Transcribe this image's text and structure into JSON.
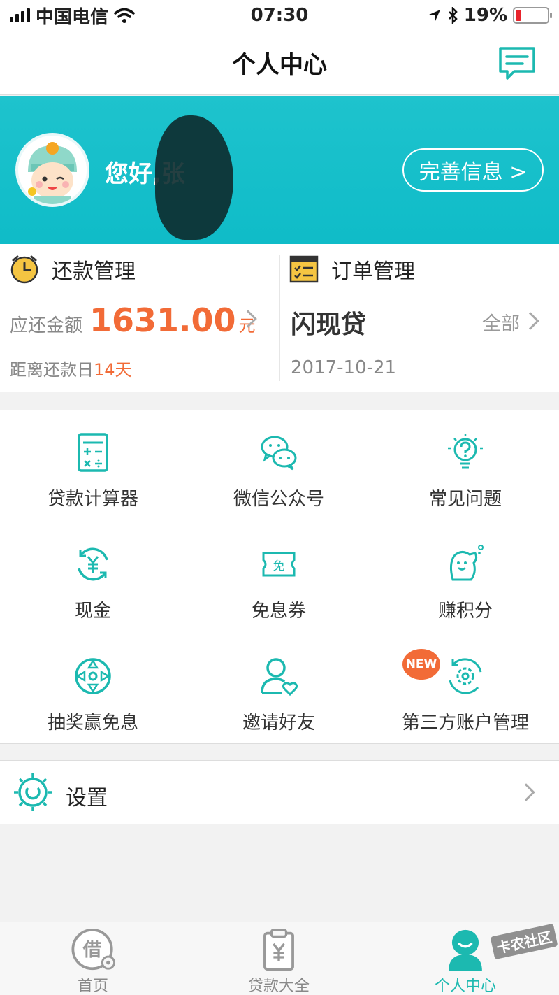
{
  "status_bar": {
    "carrier": "中国电信",
    "time": "07:30",
    "battery": "19%",
    "battery_level": 0.19
  },
  "header": {
    "title": "个人中心",
    "message_icon": "chat-icon"
  },
  "profile": {
    "greeting": "您好,张",
    "complete_button": "完善信息 >"
  },
  "repayment": {
    "title": "还款管理",
    "amount_label": "应还金额",
    "amount": "1631.00",
    "unit": "元",
    "days_label": "距离还款日",
    "days_value": "14天"
  },
  "orders": {
    "title": "订单管理",
    "product": "闪现贷",
    "all_link": "全部",
    "date": "2017-10-21"
  },
  "menu": {
    "items": [
      {
        "label": "贷款计算器",
        "icon": "calculator-icon"
      },
      {
        "label": "微信公众号",
        "icon": "wechat-icon"
      },
      {
        "label": "常见问题",
        "icon": "faq-bulb-icon"
      },
      {
        "label": "现金",
        "icon": "cash-icon"
      },
      {
        "label": "免息券",
        "icon": "coupon-icon"
      },
      {
        "label": "赚积分",
        "icon": "points-icon"
      },
      {
        "label": "抽奖赢免息",
        "icon": "lottery-wheel-icon"
      },
      {
        "label": "邀请好友",
        "icon": "invite-friend-icon"
      },
      {
        "label": "第三方账户管理",
        "icon": "account-settings-icon"
      }
    ],
    "new_badge": "NEW"
  },
  "settings": {
    "label": "设置"
  },
  "tabs": [
    {
      "label": "首页",
      "icon": "home-icon"
    },
    {
      "label": "贷款大全",
      "icon": "loans-icon"
    },
    {
      "label": "个人中心",
      "icon": "profile-icon"
    }
  ],
  "watermark": "卡农社区",
  "colors": {
    "accent": "#1ec3cd",
    "orange": "#f26b37",
    "teal_icon": "#1cb9b0"
  }
}
